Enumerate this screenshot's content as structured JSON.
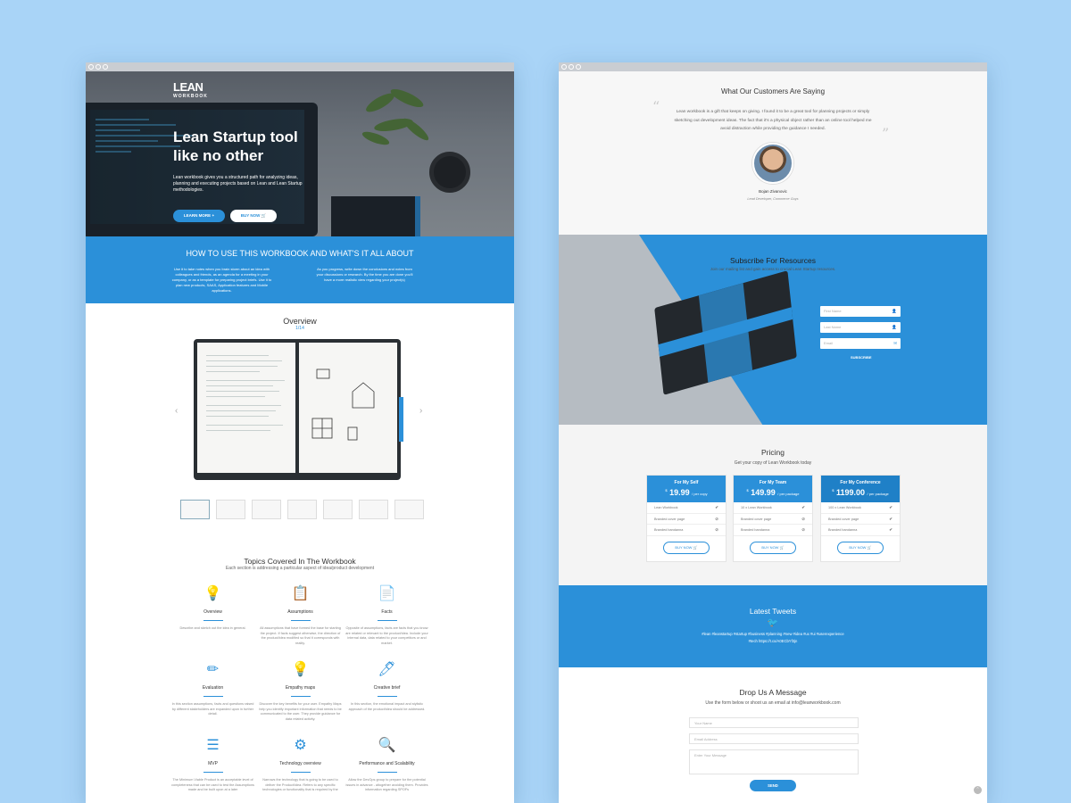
{
  "left": {
    "hero": {
      "logo_top": "LEAN",
      "logo_bottom": "WORKBOOK",
      "title": "Lean Startup tool like no other",
      "text": "Lean workbook gives you a structured path for analyzing ideas, planning and executing projects based on Lean and Lean Startup methodologies.",
      "learn_more": "LEARN MORE",
      "buy_now": "BUY NOW"
    },
    "howto": {
      "title": "HOW TO USE THIS WORKBOOK AND WHAT'S IT ALL ABOUT",
      "col1": "Use it to take notes when you brain storm about an idea with colleagues and friends, as an agenda for a meeting in your company, or as a template for preparing project briefs. Use it to plan new products, SAAS, Application features and Mobile applications.",
      "col2": "As you progress, write down the conclusions and notes from your discussions or research. By the time you are done you'll have a more realistic view regarding your project(s)"
    },
    "overview": {
      "title": "Overview",
      "count": "1/14"
    },
    "topics": {
      "title": "Topics Covered In The Workbook",
      "sub": "Each section is addressing a particular aspect of idea/product development",
      "items": [
        {
          "title": "Overview",
          "desc": "Describe and sketch out the idea in general."
        },
        {
          "title": "Assumptions",
          "desc": "All assumptions that have formed the base for starting the project. If facts suggest otherwise, the direction of the product/idea modified so that it corresponds with reality."
        },
        {
          "title": "Facts",
          "desc": "Opposite of assumptions, facts are facts that you know are related or relevant to the product/idea. Include your internal data, data related to your competitors or and market."
        },
        {
          "title": "Evaluation",
          "desc": "In this section assumptions, facts and questions raised by different stakeholders are expanded upon in further detail."
        },
        {
          "title": "Empathy maps",
          "desc": "Discover the key benefits for your user. Empathy Maps help you identify important information that needs to be communicated to the user. They provide guidance for data related activity."
        },
        {
          "title": "Creative brief",
          "desc": "In this section, the emotional impact and stylistic approach of the product/idea should be addressed."
        },
        {
          "title": "MVP",
          "desc": "The Minimum Viable Product is an acceptable level of completeness that can be used to test the Assumptions made and be built upon at a later"
        },
        {
          "title": "Technology overview",
          "desc": "Narrows the technology that is going to be used to deliver the Product/idea. Refers to any specific technologies or functionality that is required by the"
        },
        {
          "title": "Performance and Scalability",
          "desc": "Allow the DevOps group to prepare for the potential issues in advance - altogether avoiding them. Provides information regarding SPOFs"
        }
      ]
    }
  },
  "right": {
    "testimonial": {
      "title": "What Our Customers Are Saying",
      "quote": "Lean workbook is a gift that keeps on giving. I found it to be a great tool for planning projects or simply sketching out development ideas. The fact that it's a physical object rather than an online tool helped me avoid distraction while providing the guidance I needed.",
      "name": "Bojan Zivanovic",
      "role": "Lead Developer, Commerce Guys"
    },
    "subscribe": {
      "title": "Subscribe For Resources",
      "sub": "Join our mailing list and gain access to crucial Lean Startup resources.",
      "first": "First Name",
      "last": "Last Name",
      "email": "Email",
      "button": "SUBSCRIBE"
    },
    "pricing": {
      "title": "Pricing",
      "sub": "Get your copy of Lean Workbook today",
      "plans": [
        {
          "name": "For My Self",
          "currency": "$",
          "price": "19.99",
          "unit": "/ per copy",
          "f1": "Lean Workbook",
          "f2": "Branded cover page",
          "f3": "Branded bandanna",
          "button": "BUY NOW"
        },
        {
          "name": "For My Team",
          "currency": "$",
          "price": "149.99",
          "unit": "/ per package",
          "f1": "10 x Lean Workbook",
          "f2": "Branded cover page",
          "f3": "Branded bandanna",
          "button": "BUY NOW"
        },
        {
          "name": "For My Conference",
          "currency": "$",
          "price": "1199.00",
          "unit": "/ per package",
          "f1": "100 x Lean Workbook",
          "f2": "Branded cover page",
          "f3": "Branded bandanna",
          "button": "BUY NOW"
        }
      ]
    },
    "tweets": {
      "title": "Latest Tweets",
      "text": "#lean #leanstartup #startup #business #planning #new #idea #ux #ui #userexperience #tech   https://t.co/A0ECbYf3jn"
    },
    "contact": {
      "title": "Drop Us A Message",
      "sub": "Use the form below or shoot us an email at info@leanworkbook.com",
      "name": "Your Name",
      "email": "Email Address",
      "message": "Enter Your Message",
      "send": "SEND"
    }
  },
  "colors": {
    "accent": "#2b90d9",
    "background": "#a9d4f7"
  }
}
